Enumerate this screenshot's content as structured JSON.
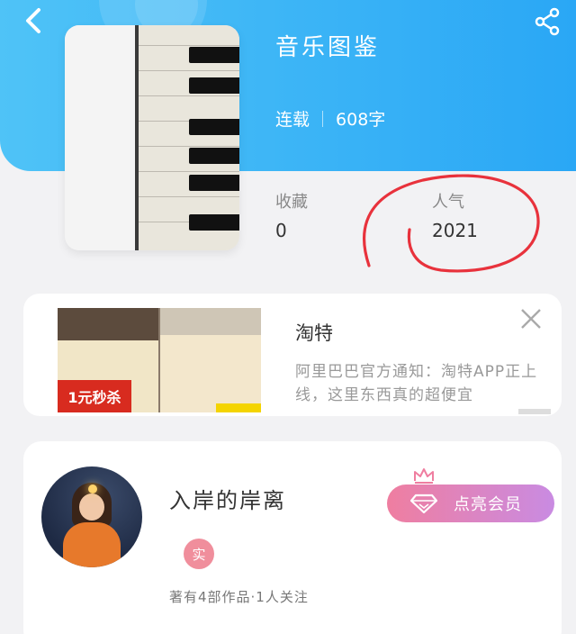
{
  "header": {
    "title": "音乐图鉴",
    "status": "连载",
    "word_count": "608字"
  },
  "stats": {
    "collect_label": "收藏",
    "collect_value": "0",
    "popularity_label": "人气",
    "popularity_value": "2021"
  },
  "ad": {
    "image_badge": "1元秒杀",
    "name": "淘特",
    "description": "阿里巴巴官方通知：淘特APP正上线，这里东西真的超便宜"
  },
  "author": {
    "name": "入岸的岸离",
    "verified_badge": "实",
    "meta": "著有4部作品·1人关注",
    "vip_button_label": "点亮会员"
  },
  "icons": {
    "back": "back-arrow-icon",
    "share": "share-icon",
    "close": "close-icon",
    "diamond": "diamond-icon",
    "crown": "crown-icon"
  },
  "colors": {
    "header_blue": "#2aa7f5",
    "annotation_red": "#e8323c",
    "vip_pink": "#ef7ea0",
    "vip_purple": "#c98be2"
  }
}
